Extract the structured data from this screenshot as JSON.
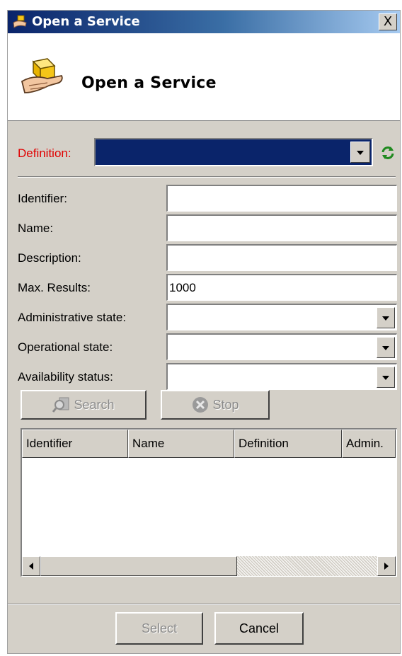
{
  "window": {
    "title": "Open a Service",
    "close_label": "X"
  },
  "header": {
    "title": "Open a Service"
  },
  "definition": {
    "label": "Definition:",
    "value": ""
  },
  "form": {
    "identifier": {
      "label": "Identifier:",
      "value": ""
    },
    "name": {
      "label": "Name:",
      "value": ""
    },
    "description": {
      "label": "Description:",
      "value": ""
    },
    "max_results": {
      "label": "Max. Results:",
      "value": "1000"
    },
    "administrative_state": {
      "label": "Administrative state:",
      "value": ""
    },
    "operational_state": {
      "label": "Operational state:",
      "value": ""
    },
    "availability_status": {
      "label": "Availability status:",
      "value": ""
    }
  },
  "actions": {
    "search_label": "Search",
    "stop_label": "Stop"
  },
  "table": {
    "columns": [
      "Identifier",
      "Name",
      "Definition",
      "Admin."
    ],
    "rows": []
  },
  "footer": {
    "select_label": "Select",
    "cancel_label": "Cancel"
  },
  "colors": {
    "title_bar_start": "#0a246a",
    "definition_label": "#e00000",
    "selected_field": "#0a246a",
    "refresh_icon": "#1f8a1f"
  },
  "icons": {
    "app": "service-hand-icon",
    "header": "hand-with-box-icon",
    "refresh": "refresh-icon",
    "search": "search-icon",
    "stop": "stop-icon"
  }
}
